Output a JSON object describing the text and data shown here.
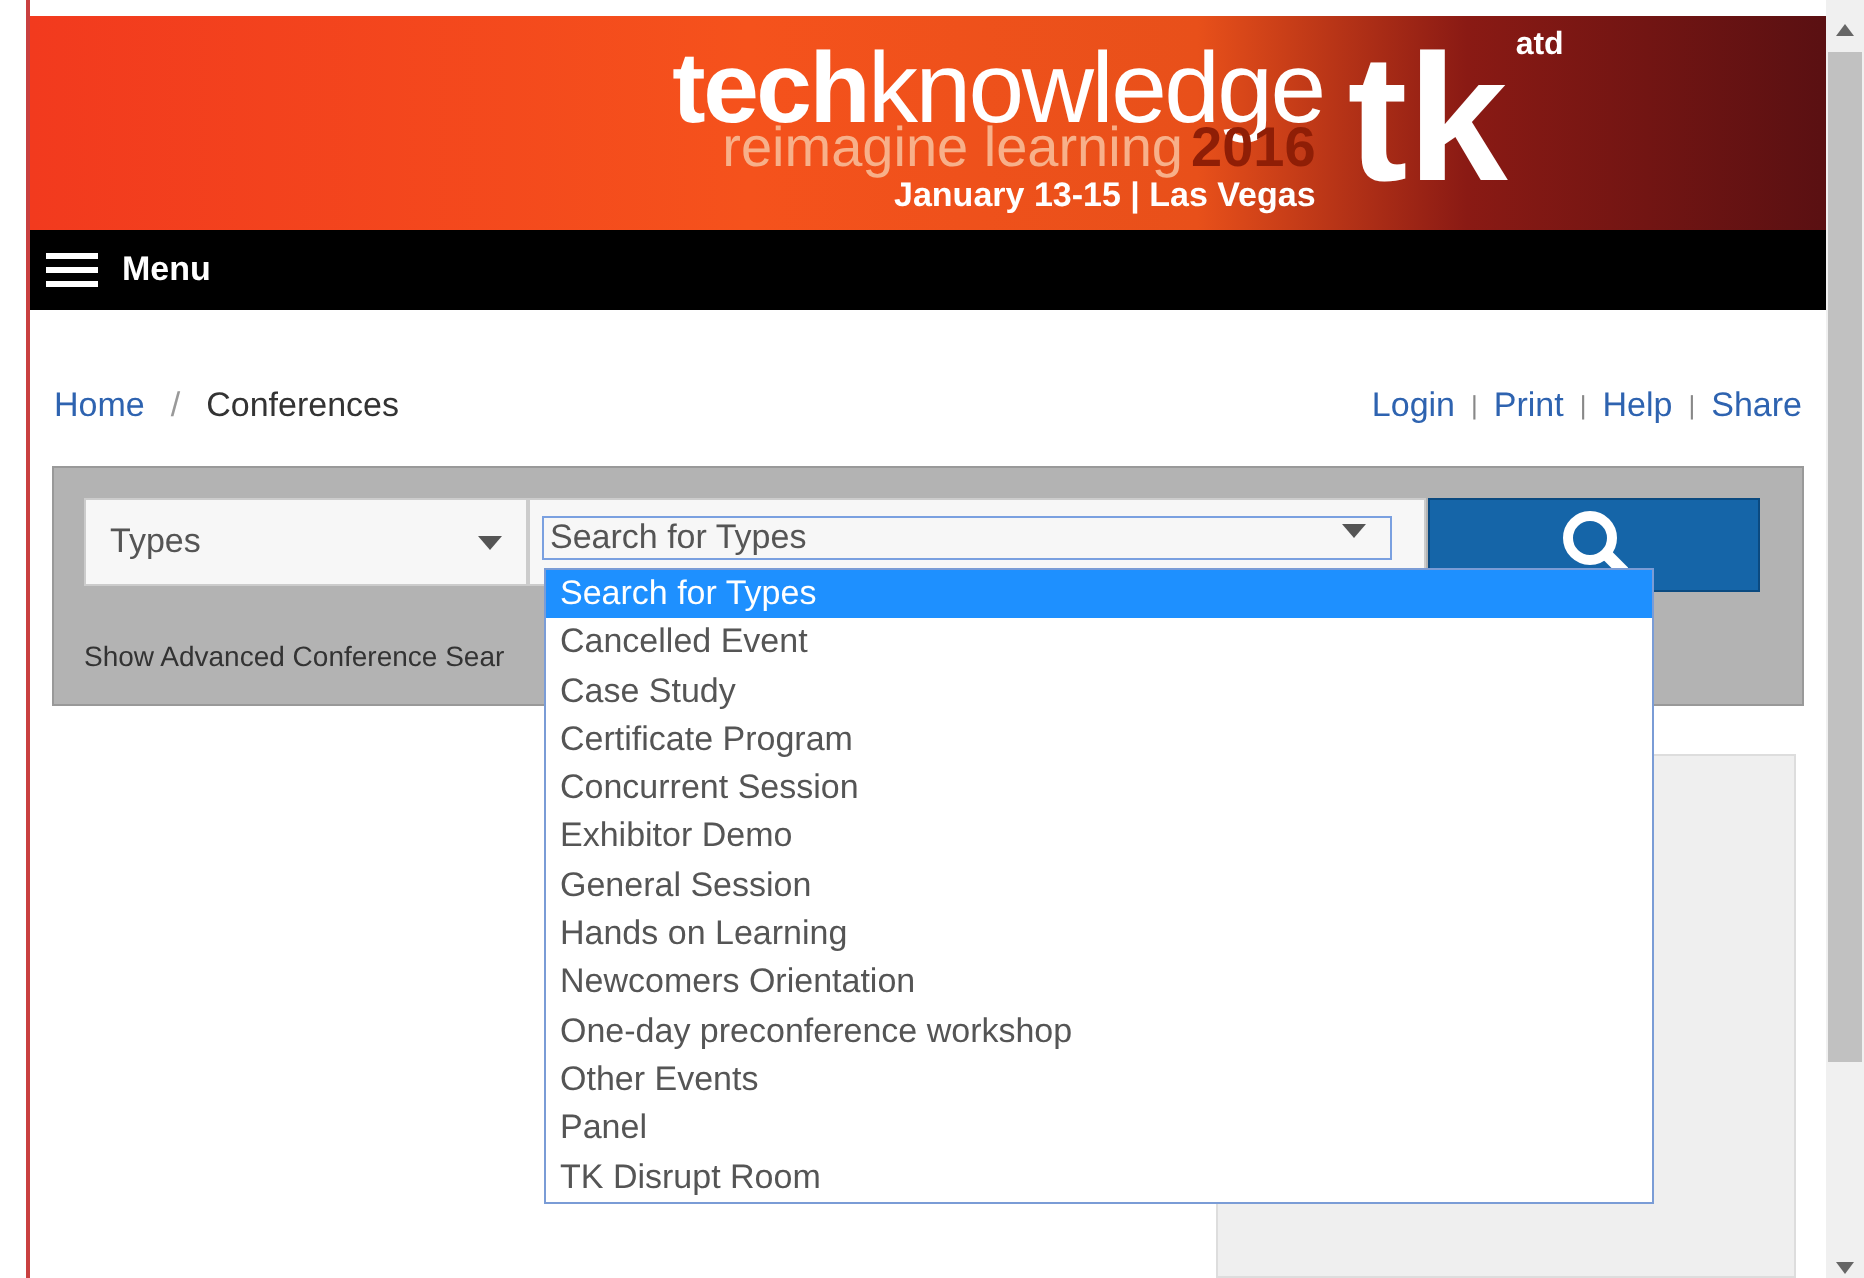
{
  "banner": {
    "title_bold": "tech",
    "title_light": "knowledge",
    "tagline": "reimagine learning",
    "year": "2016",
    "dates": "January 13-15 | Las Vegas",
    "mark": "tk",
    "mark_sup": "atd"
  },
  "menu": {
    "label": "Menu"
  },
  "breadcrumb": [
    {
      "kind": "link",
      "text": "Home"
    },
    {
      "kind": "separator",
      "text": "/"
    },
    {
      "kind": "current",
      "text": "Conferences"
    }
  ],
  "top_links": [
    {
      "kind": "link",
      "text": "Login"
    },
    {
      "kind": "separator",
      "text": "|"
    },
    {
      "kind": "link",
      "text": "Print"
    },
    {
      "kind": "separator",
      "text": "|"
    },
    {
      "kind": "link",
      "text": "Help"
    },
    {
      "kind": "separator",
      "text": "|"
    },
    {
      "kind": "link",
      "text": "Share"
    }
  ],
  "search": {
    "category": "Types",
    "type_select": "Search for Types",
    "advanced_link": "Show Advanced Conference Sear"
  },
  "dropdown": [
    {
      "label": "Search for Types",
      "selected": true
    },
    {
      "label": "Cancelled Event",
      "selected": false
    },
    {
      "label": "Case Study",
      "selected": false
    },
    {
      "label": "Certificate Program",
      "selected": false
    },
    {
      "label": "Concurrent Session",
      "selected": false
    },
    {
      "label": "Exhibitor Demo",
      "selected": false
    },
    {
      "label": "General Session",
      "selected": false
    },
    {
      "label": "Hands on Learning",
      "selected": false
    },
    {
      "label": "Newcomers Orientation",
      "selected": false
    },
    {
      "label": "One-day preconference workshop",
      "selected": false
    },
    {
      "label": "Other Events",
      "selected": false
    },
    {
      "label": "Panel",
      "selected": false
    },
    {
      "label": "TK Disrupt Room",
      "selected": false
    }
  ]
}
